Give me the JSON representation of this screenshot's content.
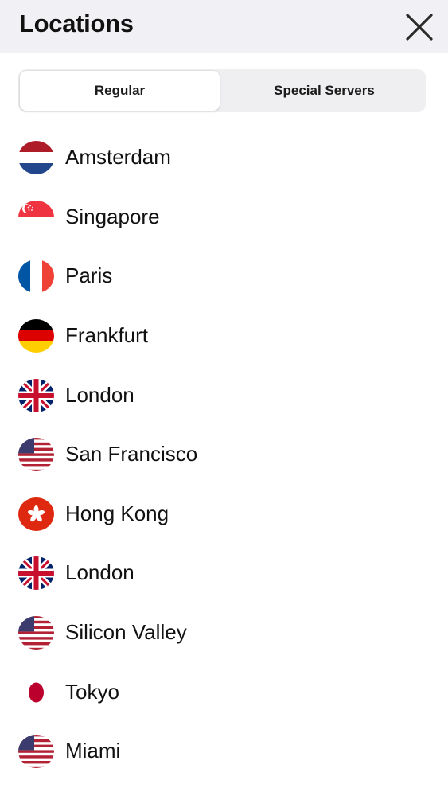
{
  "header": {
    "title": "Locations",
    "close_icon": "close-icon"
  },
  "tabs": [
    {
      "label": "Regular",
      "selected": true
    },
    {
      "label": "Special Servers",
      "selected": false
    }
  ],
  "locations": [
    {
      "name": "Amsterdam",
      "flag": "netherlands-flag-icon"
    },
    {
      "name": "Singapore",
      "flag": "singapore-flag-icon"
    },
    {
      "name": "Paris",
      "flag": "france-flag-icon"
    },
    {
      "name": "Frankfurt",
      "flag": "germany-flag-icon"
    },
    {
      "name": "London",
      "flag": "uk-flag-icon"
    },
    {
      "name": "San Francisco",
      "flag": "us-flag-icon"
    },
    {
      "name": "Hong Kong",
      "flag": "hong-kong-flag-icon"
    },
    {
      "name": "London",
      "flag": "uk-flag-icon"
    },
    {
      "name": "Silicon Valley",
      "flag": "us-flag-icon"
    },
    {
      "name": "Tokyo",
      "flag": "japan-flag-icon"
    },
    {
      "name": "Miami",
      "flag": "us-flag-icon"
    }
  ],
  "colors": {
    "header_bg": "#f1f1f5",
    "segment_bg": "#efeff1",
    "text": "#111111"
  }
}
